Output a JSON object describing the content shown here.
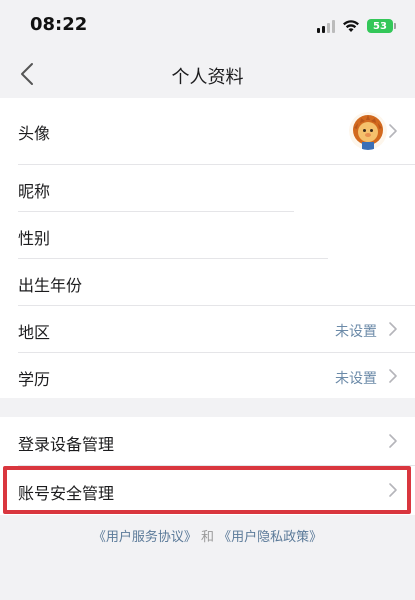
{
  "status_bar": {
    "time": "08:22",
    "battery": "53"
  },
  "nav": {
    "title": "个人资料"
  },
  "profile": {
    "avatar_label": "头像",
    "nickname_label": "昵称",
    "gender_label": "性别",
    "birth_year_label": "出生年份",
    "region_label": "地区",
    "region_value": "未设置",
    "education_label": "学历",
    "education_value": "未设置"
  },
  "security": {
    "login_devices_label": "登录设备管理",
    "account_security_label": "账号安全管理"
  },
  "footer": {
    "user_agreement": "《用户服务协议》",
    "and": "和",
    "privacy_policy": "《用户隐私政策》"
  },
  "colors": {
    "highlight": "#d9363e",
    "link": "#5b7a99",
    "value_text": "#6b8aa8",
    "battery": "#34c759"
  }
}
